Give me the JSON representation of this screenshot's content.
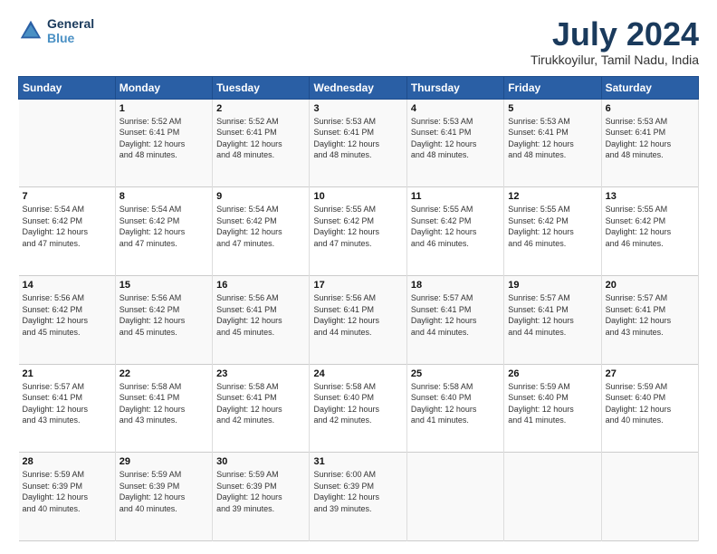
{
  "logo": {
    "line1": "General",
    "line2": "Blue"
  },
  "title": "July 2024",
  "subtitle": "Tirukkoyilur, Tamil Nadu, India",
  "weekdays": [
    "Sunday",
    "Monday",
    "Tuesday",
    "Wednesday",
    "Thursday",
    "Friday",
    "Saturday"
  ],
  "weeks": [
    [
      {
        "day": "",
        "info": ""
      },
      {
        "day": "1",
        "info": "Sunrise: 5:52 AM\nSunset: 6:41 PM\nDaylight: 12 hours\nand 48 minutes."
      },
      {
        "day": "2",
        "info": "Sunrise: 5:52 AM\nSunset: 6:41 PM\nDaylight: 12 hours\nand 48 minutes."
      },
      {
        "day": "3",
        "info": "Sunrise: 5:53 AM\nSunset: 6:41 PM\nDaylight: 12 hours\nand 48 minutes."
      },
      {
        "day": "4",
        "info": "Sunrise: 5:53 AM\nSunset: 6:41 PM\nDaylight: 12 hours\nand 48 minutes."
      },
      {
        "day": "5",
        "info": "Sunrise: 5:53 AM\nSunset: 6:41 PM\nDaylight: 12 hours\nand 48 minutes."
      },
      {
        "day": "6",
        "info": "Sunrise: 5:53 AM\nSunset: 6:41 PM\nDaylight: 12 hours\nand 48 minutes."
      }
    ],
    [
      {
        "day": "7",
        "info": "Sunrise: 5:54 AM\nSunset: 6:42 PM\nDaylight: 12 hours\nand 47 minutes."
      },
      {
        "day": "8",
        "info": "Sunrise: 5:54 AM\nSunset: 6:42 PM\nDaylight: 12 hours\nand 47 minutes."
      },
      {
        "day": "9",
        "info": "Sunrise: 5:54 AM\nSunset: 6:42 PM\nDaylight: 12 hours\nand 47 minutes."
      },
      {
        "day": "10",
        "info": "Sunrise: 5:55 AM\nSunset: 6:42 PM\nDaylight: 12 hours\nand 47 minutes."
      },
      {
        "day": "11",
        "info": "Sunrise: 5:55 AM\nSunset: 6:42 PM\nDaylight: 12 hours\nand 46 minutes."
      },
      {
        "day": "12",
        "info": "Sunrise: 5:55 AM\nSunset: 6:42 PM\nDaylight: 12 hours\nand 46 minutes."
      },
      {
        "day": "13",
        "info": "Sunrise: 5:55 AM\nSunset: 6:42 PM\nDaylight: 12 hours\nand 46 minutes."
      }
    ],
    [
      {
        "day": "14",
        "info": "Sunrise: 5:56 AM\nSunset: 6:42 PM\nDaylight: 12 hours\nand 45 minutes."
      },
      {
        "day": "15",
        "info": "Sunrise: 5:56 AM\nSunset: 6:42 PM\nDaylight: 12 hours\nand 45 minutes."
      },
      {
        "day": "16",
        "info": "Sunrise: 5:56 AM\nSunset: 6:41 PM\nDaylight: 12 hours\nand 45 minutes."
      },
      {
        "day": "17",
        "info": "Sunrise: 5:56 AM\nSunset: 6:41 PM\nDaylight: 12 hours\nand 44 minutes."
      },
      {
        "day": "18",
        "info": "Sunrise: 5:57 AM\nSunset: 6:41 PM\nDaylight: 12 hours\nand 44 minutes."
      },
      {
        "day": "19",
        "info": "Sunrise: 5:57 AM\nSunset: 6:41 PM\nDaylight: 12 hours\nand 44 minutes."
      },
      {
        "day": "20",
        "info": "Sunrise: 5:57 AM\nSunset: 6:41 PM\nDaylight: 12 hours\nand 43 minutes."
      }
    ],
    [
      {
        "day": "21",
        "info": "Sunrise: 5:57 AM\nSunset: 6:41 PM\nDaylight: 12 hours\nand 43 minutes."
      },
      {
        "day": "22",
        "info": "Sunrise: 5:58 AM\nSunset: 6:41 PM\nDaylight: 12 hours\nand 43 minutes."
      },
      {
        "day": "23",
        "info": "Sunrise: 5:58 AM\nSunset: 6:41 PM\nDaylight: 12 hours\nand 42 minutes."
      },
      {
        "day": "24",
        "info": "Sunrise: 5:58 AM\nSunset: 6:40 PM\nDaylight: 12 hours\nand 42 minutes."
      },
      {
        "day": "25",
        "info": "Sunrise: 5:58 AM\nSunset: 6:40 PM\nDaylight: 12 hours\nand 41 minutes."
      },
      {
        "day": "26",
        "info": "Sunrise: 5:59 AM\nSunset: 6:40 PM\nDaylight: 12 hours\nand 41 minutes."
      },
      {
        "day": "27",
        "info": "Sunrise: 5:59 AM\nSunset: 6:40 PM\nDaylight: 12 hours\nand 40 minutes."
      }
    ],
    [
      {
        "day": "28",
        "info": "Sunrise: 5:59 AM\nSunset: 6:39 PM\nDaylight: 12 hours\nand 40 minutes."
      },
      {
        "day": "29",
        "info": "Sunrise: 5:59 AM\nSunset: 6:39 PM\nDaylight: 12 hours\nand 40 minutes."
      },
      {
        "day": "30",
        "info": "Sunrise: 5:59 AM\nSunset: 6:39 PM\nDaylight: 12 hours\nand 39 minutes."
      },
      {
        "day": "31",
        "info": "Sunrise: 6:00 AM\nSunset: 6:39 PM\nDaylight: 12 hours\nand 39 minutes."
      },
      {
        "day": "",
        "info": ""
      },
      {
        "day": "",
        "info": ""
      },
      {
        "day": "",
        "info": ""
      }
    ]
  ]
}
